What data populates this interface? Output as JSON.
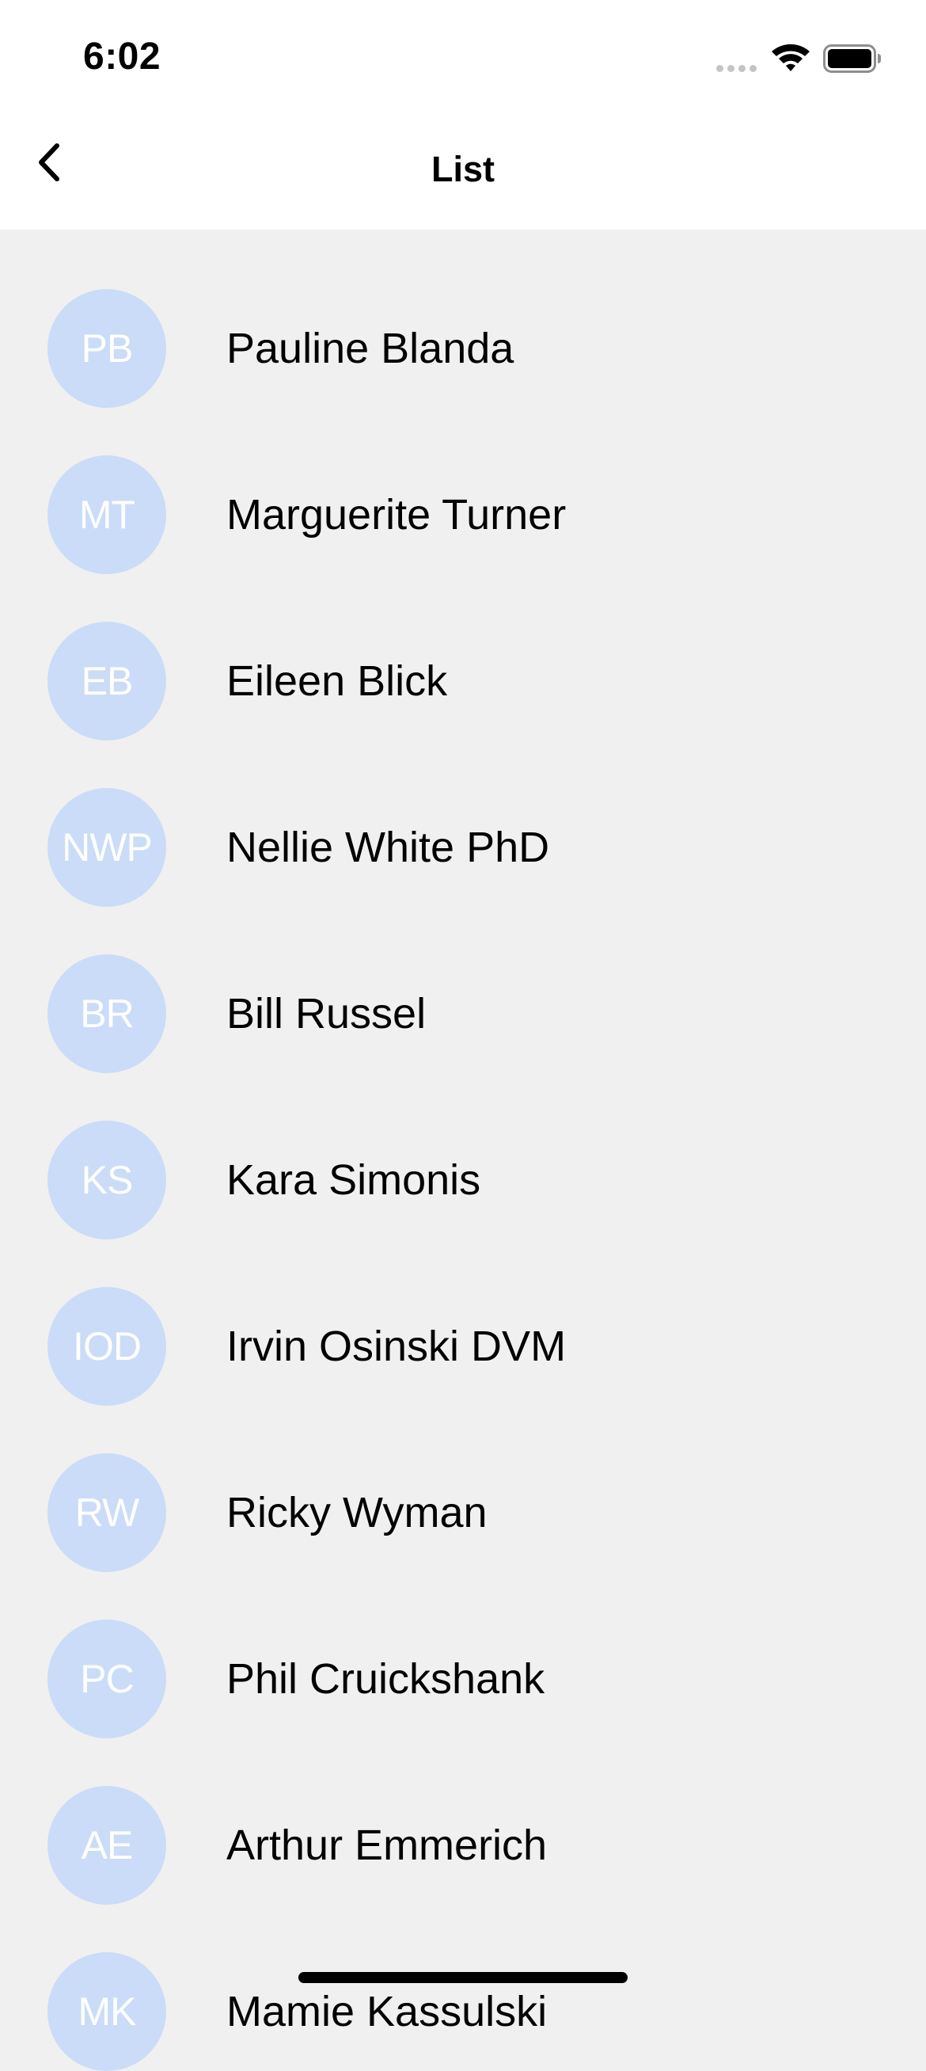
{
  "status_bar": {
    "time": "6:02",
    "icons": [
      "cellular-signal-icon",
      "wifi-icon",
      "battery-icon"
    ]
  },
  "nav": {
    "title": "List",
    "back_icon": "chevron-left-icon"
  },
  "colors": {
    "avatar_background": "#cadcf7",
    "avatar_text": "#ffffff",
    "list_background": "#f0f0f0",
    "header_background": "#ffffff"
  },
  "list": {
    "items": [
      {
        "initials": "PB",
        "name": "Pauline Blanda"
      },
      {
        "initials": "MT",
        "name": "Marguerite Turner"
      },
      {
        "initials": "EB",
        "name": "Eileen Blick"
      },
      {
        "initials": "NWP",
        "name": "Nellie White PhD"
      },
      {
        "initials": "BR",
        "name": "Bill Russel"
      },
      {
        "initials": "KS",
        "name": "Kara Simonis"
      },
      {
        "initials": "IOD",
        "name": "Irvin Osinski DVM"
      },
      {
        "initials": "RW",
        "name": "Ricky Wyman"
      },
      {
        "initials": "PC",
        "name": "Phil Cruickshank"
      },
      {
        "initials": "AE",
        "name": "Arthur Emmerich"
      },
      {
        "initials": "MK",
        "name": "Mamie Kassulski"
      }
    ]
  }
}
